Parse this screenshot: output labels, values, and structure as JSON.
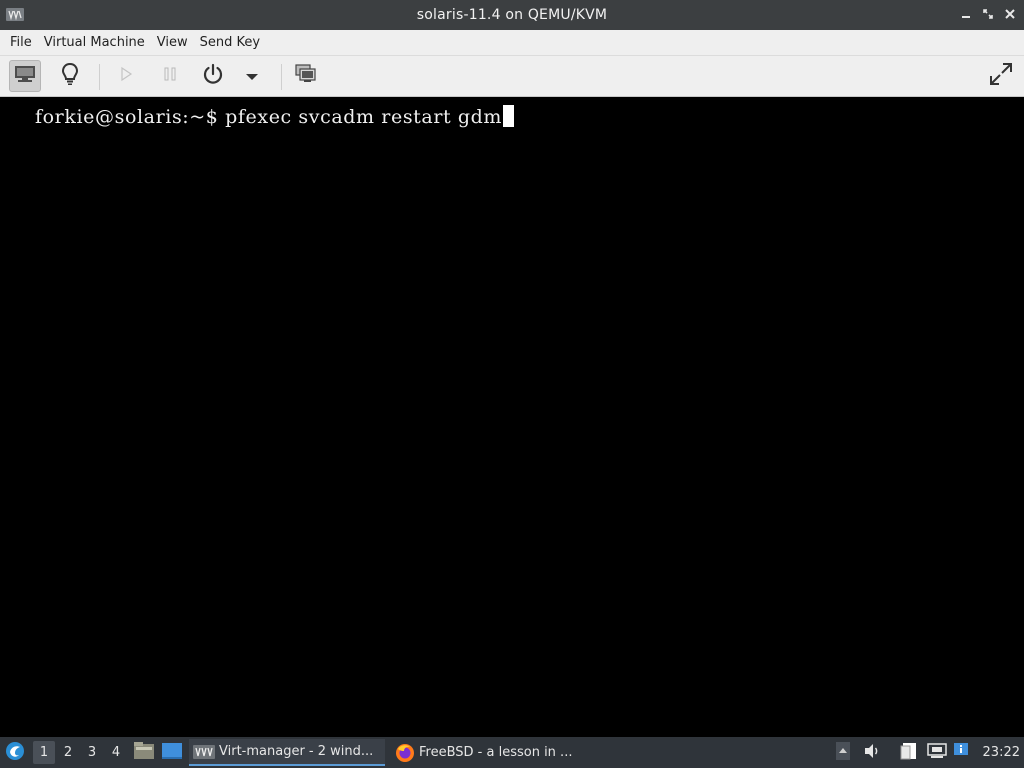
{
  "window": {
    "title": "solaris-11.4 on QEMU/KVM",
    "controls": [
      "minimize",
      "maximize",
      "close"
    ]
  },
  "menubar": {
    "items": [
      "File",
      "Virtual Machine",
      "View",
      "Send Key"
    ]
  },
  "toolbar": {
    "buttons": [
      {
        "name": "show-console",
        "icon": "monitor-icon",
        "active": true
      },
      {
        "name": "show-details",
        "icon": "lightbulb-icon",
        "active": false
      },
      {
        "name": "run",
        "icon": "play-icon",
        "enabled": false
      },
      {
        "name": "pause",
        "icon": "pause-icon",
        "enabled": false
      },
      {
        "name": "shutdown",
        "icon": "power-icon"
      },
      {
        "name": "shutdown-menu",
        "icon": "dropdown-arrow-icon"
      },
      {
        "name": "snapshots",
        "icon": "snapshots-icon"
      },
      {
        "name": "fullscreen",
        "icon": "fullscreen-icon"
      }
    ]
  },
  "console": {
    "prompt": "forkie@solaris:~$ ",
    "command": "pfexec svcadm restart gdm"
  },
  "taskbar": {
    "workspaces": [
      "1",
      "2",
      "3",
      "4"
    ],
    "active_workspace": "1",
    "tasks": [
      {
        "label": "Virt-manager - 2 wind...",
        "icon": "virt-manager-icon",
        "active": true
      },
      {
        "label": "FreeBSD - a lesson in ...",
        "icon": "firefox-icon",
        "active": false
      }
    ],
    "clock": "23:22"
  },
  "colors": {
    "titlebar": "#3c3f41",
    "menubar": "#efefef",
    "console_bg": "#000000",
    "taskbar": "#2f343a",
    "accent": "#5b9bd5"
  }
}
